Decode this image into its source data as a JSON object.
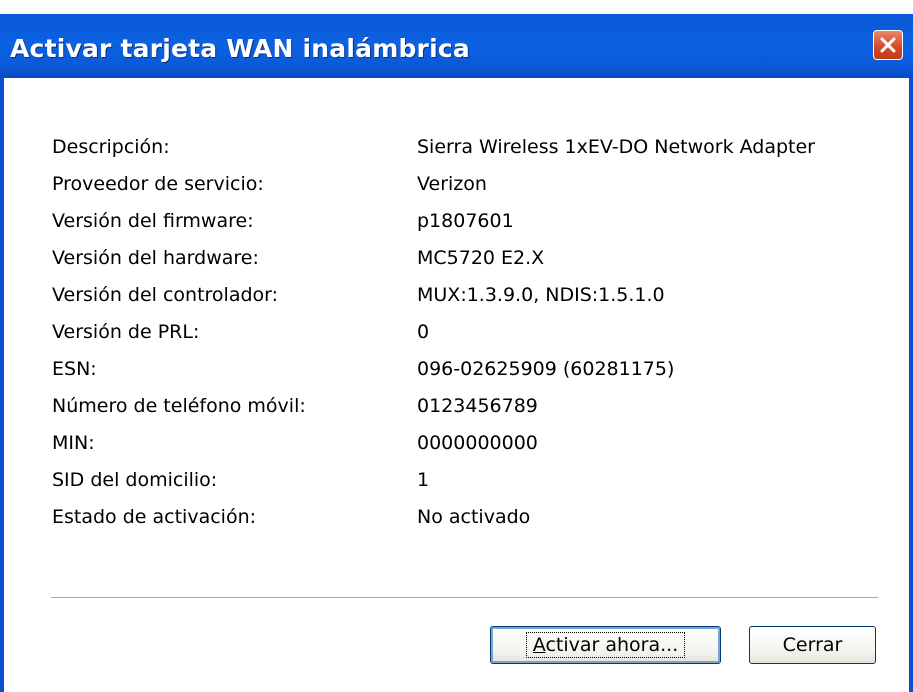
{
  "window": {
    "title": "Activar tarjeta WAN inalámbrica"
  },
  "details": [
    {
      "label": "Descripción:",
      "value": "Sierra Wireless 1xEV-DO Network Adapter"
    },
    {
      "label": "Proveedor de servicio:",
      "value": "Verizon"
    },
    {
      "label": "Versión del firmware:",
      "value": "p1807601"
    },
    {
      "label": "Versión del hardware:",
      "value": "MC5720 E2.X"
    },
    {
      "label": "Versión del controlador:",
      "value": "MUX:1.3.9.0, NDIS:1.5.1.0"
    },
    {
      "label": "Versión de PRL:",
      "value": "0"
    },
    {
      "label": "ESN:",
      "value": "096-02625909 (60281175)"
    },
    {
      "label": "Número de teléfono móvil:",
      "value": "0123456789"
    },
    {
      "label": "MIN:",
      "value": "0000000000"
    },
    {
      "label": "SID del domicilio:",
      "value": "1"
    },
    {
      "label": "Estado de activación:",
      "value": "No activado"
    }
  ],
  "buttons": {
    "activate": "Activar ahora...",
    "close": "Cerrar"
  },
  "icons": {
    "close": "close-icon"
  },
  "colors": {
    "titlebar": "#0a5fdc",
    "close_button": "#d34727"
  }
}
